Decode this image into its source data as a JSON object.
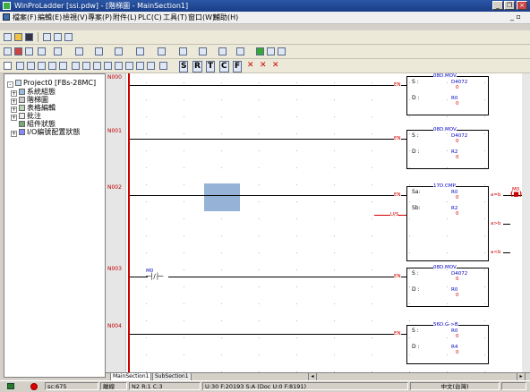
{
  "window": {
    "title": "WinProLadder [ssi.pdw] - [階梯圖 - MainSection1]",
    "minimize": "_",
    "restore": "❐",
    "close": "×",
    "mdi_restore": "_ ▫"
  },
  "menu": [
    "檔案(F)",
    "編輯(E)",
    "檢視(V)",
    "專案(P)",
    "附件(L)",
    "PLC(C)",
    "工具(T)",
    "窗口(W)",
    "輔助(H)"
  ],
  "toolbar3_glyphs": [
    "S",
    "R",
    "T",
    "C",
    "F",
    "✕",
    "✕",
    "✕"
  ],
  "tree": {
    "root": "Project0 [FBs-28MC]",
    "items": [
      "系統組態",
      "階梯圖",
      "表格編輯",
      "批注",
      "組件狀態",
      "I/O編號配置狀態"
    ]
  },
  "rungs": [
    {
      "id": "N000",
      "fn": "08D.MOV",
      "rows": [
        {
          "lbl": "S :",
          "op": "D4072",
          "v": "0"
        },
        {
          "lbl": "D :",
          "op": "R0",
          "v": "0"
        }
      ]
    },
    {
      "id": "N001",
      "fn": "08D.MOV",
      "rows": [
        {
          "lbl": "S :",
          "op": "D4072",
          "v": "0"
        },
        {
          "lbl": "D :",
          "op": "R2",
          "v": "0"
        }
      ]
    },
    {
      "id": "N002",
      "fn": "17D.CMP",
      "rows": [
        {
          "lbl": "Sa:",
          "op": "R0",
          "v": "0"
        },
        {
          "lbl": "Sb:",
          "op": "R2",
          "v": "0"
        }
      ],
      "outs": [
        "a=b",
        "a>b",
        "a<b"
      ],
      "in2": "U/S",
      "coil": "M0"
    },
    {
      "id": "N003",
      "fn": "08D.MOV",
      "contact": "M0",
      "rows": [
        {
          "lbl": "S :",
          "op": "D4072",
          "v": "0"
        },
        {
          "lbl": "D :",
          "op": "R0",
          "v": "0"
        }
      ]
    },
    {
      "id": "N004",
      "fn": "56D.G->B",
      "rows": [
        {
          "lbl": "S :",
          "op": "R0",
          "v": "0"
        },
        {
          "lbl": "D :",
          "op": "R4",
          "v": "0"
        }
      ]
    }
  ],
  "en_label": "EN",
  "tabs": [
    "MainSection1",
    "SubSection1"
  ],
  "status": {
    "scan": "sc:675",
    "mode": "離線",
    "cursor": "N2 R:1 C:3",
    "memory": "U:30 F:20193 S:A (Doc U:0 F:8191)",
    "lang": "中文(台灣)"
  }
}
